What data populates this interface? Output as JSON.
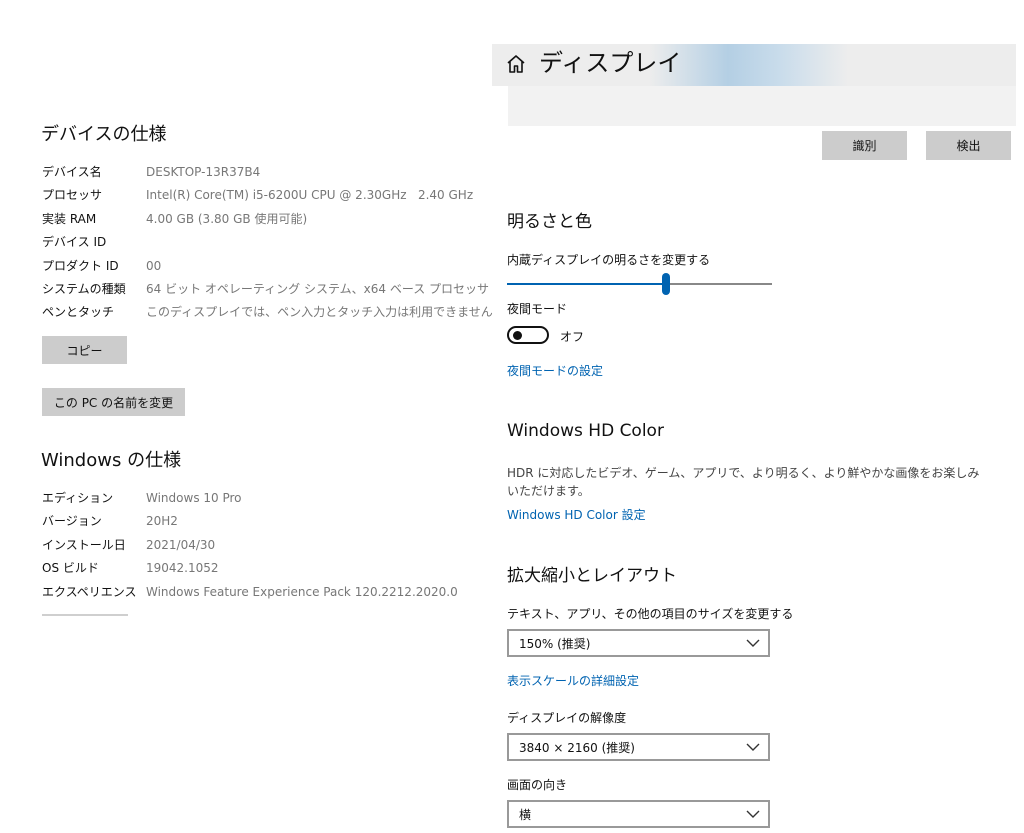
{
  "device_specs": {
    "title": "デバイスの仕様",
    "rows": [
      {
        "label": "デバイス名",
        "value": "DESKTOP-13R37B4"
      },
      {
        "label": "プロセッサ",
        "value": "Intel(R) Core(TM) i5-6200U CPU @ 2.30GHz   2.40 GHz"
      },
      {
        "label": "実装 RAM",
        "value": "4.00 GB (3.80 GB 使用可能)"
      },
      {
        "label": "デバイス ID",
        "value": ""
      },
      {
        "label": "プロダクト ID",
        "value": "00"
      },
      {
        "label": "システムの種類",
        "value": "64 ビット オペレーティング システム、x64 ベース プロセッサ"
      },
      {
        "label": "ペンとタッチ",
        "value": "このディスプレイでは、ペン入力とタッチ入力は利用できません"
      }
    ],
    "copy_button": "コピー",
    "rename_button": "この PC の名前を変更"
  },
  "windows_specs": {
    "title": "Windows の仕様",
    "rows": [
      {
        "label": "エディション",
        "value": "Windows 10 Pro"
      },
      {
        "label": "バージョン",
        "value": "20H2"
      },
      {
        "label": "インストール日",
        "value": "2021/04/30"
      },
      {
        "label": "OS ビルド",
        "value": "19042.1052"
      },
      {
        "label": "エクスペリエンス",
        "value": "Windows Feature Experience Pack 120.2212.2020.0"
      }
    ]
  },
  "display": {
    "header_icon": "home-icon",
    "title": "ディスプレイ",
    "identify_button": "識別",
    "detect_button": "検出",
    "brightness_section": {
      "title": "明るさと色",
      "slider_label": "内蔵ディスプレイの明るさを変更する",
      "brightness_value": 0.6,
      "night_mode_label": "夜間モード",
      "night_mode_state": "オフ",
      "night_mode_link": "夜間モードの設定"
    },
    "hd_color_section": {
      "title": "Windows HD Color",
      "description_line1": "HDR に対応したビデオ、ゲーム、アプリで、より明るく、より鮮やかな画像をお楽しみ",
      "description_line2": "いただけます。",
      "link": "Windows HD Color 設定"
    },
    "scale_section": {
      "title": "拡大縮小とレイアウト",
      "scale_label": "テキスト、アプリ、その他の項目のサイズを変更する",
      "scale_value": "150% (推奨)",
      "advanced_link": "表示スケールの詳細設定",
      "resolution_label": "ディスプレイの解像度",
      "resolution_value": "3840 × 2160 (推奨)",
      "orientation_label": "画面の向き",
      "orientation_value": "横"
    }
  },
  "colors": {
    "accent": "#0063b1",
    "button_gray": "#cccccc",
    "header_band": "#b4cfe4"
  }
}
